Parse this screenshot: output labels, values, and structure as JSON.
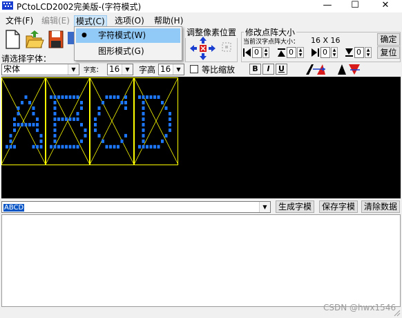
{
  "window": {
    "title": "PCtoLCD2002完美版-(字符模式)",
    "minimize_icon": "minimize-icon",
    "maximize_icon": "maximize-icon",
    "close_icon": "close-icon",
    "minimize_glyph": "—",
    "maximize_glyph": "☐",
    "close_glyph": "✕"
  },
  "menubar": {
    "items": [
      {
        "label": "文件(F)",
        "state": "normal"
      },
      {
        "label": "编辑(E)",
        "state": "disabled"
      },
      {
        "label": "模式(C)",
        "state": "active"
      },
      {
        "label": "选项(O)",
        "state": "normal"
      },
      {
        "label": "帮助(H)",
        "state": "normal"
      }
    ]
  },
  "mode_menu": {
    "items": [
      {
        "label": "字符模式(W)",
        "checked": true,
        "bullet": "●"
      },
      {
        "label": "图形模式(G)",
        "checked": false
      }
    ]
  },
  "toolbar": {
    "select_font_label": "请选择字体：",
    "pixel_position_label": "调整像素位置",
    "dot_size_label": "修改点阵大小",
    "current_size_label": "当前汉字点阵大小：",
    "current_size_value": "16 X 16",
    "confirm_button": "确定",
    "reset_button": "复位",
    "stepper_values": [
      "0",
      "0",
      "0",
      "0"
    ]
  },
  "font_bar": {
    "font_name": "宋体",
    "char_width_label": "字宽：",
    "char_width_value": "16",
    "char_height_label": "字高",
    "char_height_value": "16",
    "proportional_label": "等比缩放",
    "proportional_checked": false,
    "bold_label": "B",
    "italic_label": "I",
    "underline_label": "U"
  },
  "preview": {
    "characters": [
      "A",
      "B",
      "C",
      "D"
    ],
    "grid_color": "#ffff00",
    "dot_color": "#1e78ff",
    "background": "#000000"
  },
  "input_bar": {
    "text_value": "ABCD",
    "generate_button": "生成字模",
    "save_button": "保存字模",
    "clear_button": "清除数据"
  },
  "output": {
    "text": ""
  },
  "watermark": "CSDN @hwx1546"
}
